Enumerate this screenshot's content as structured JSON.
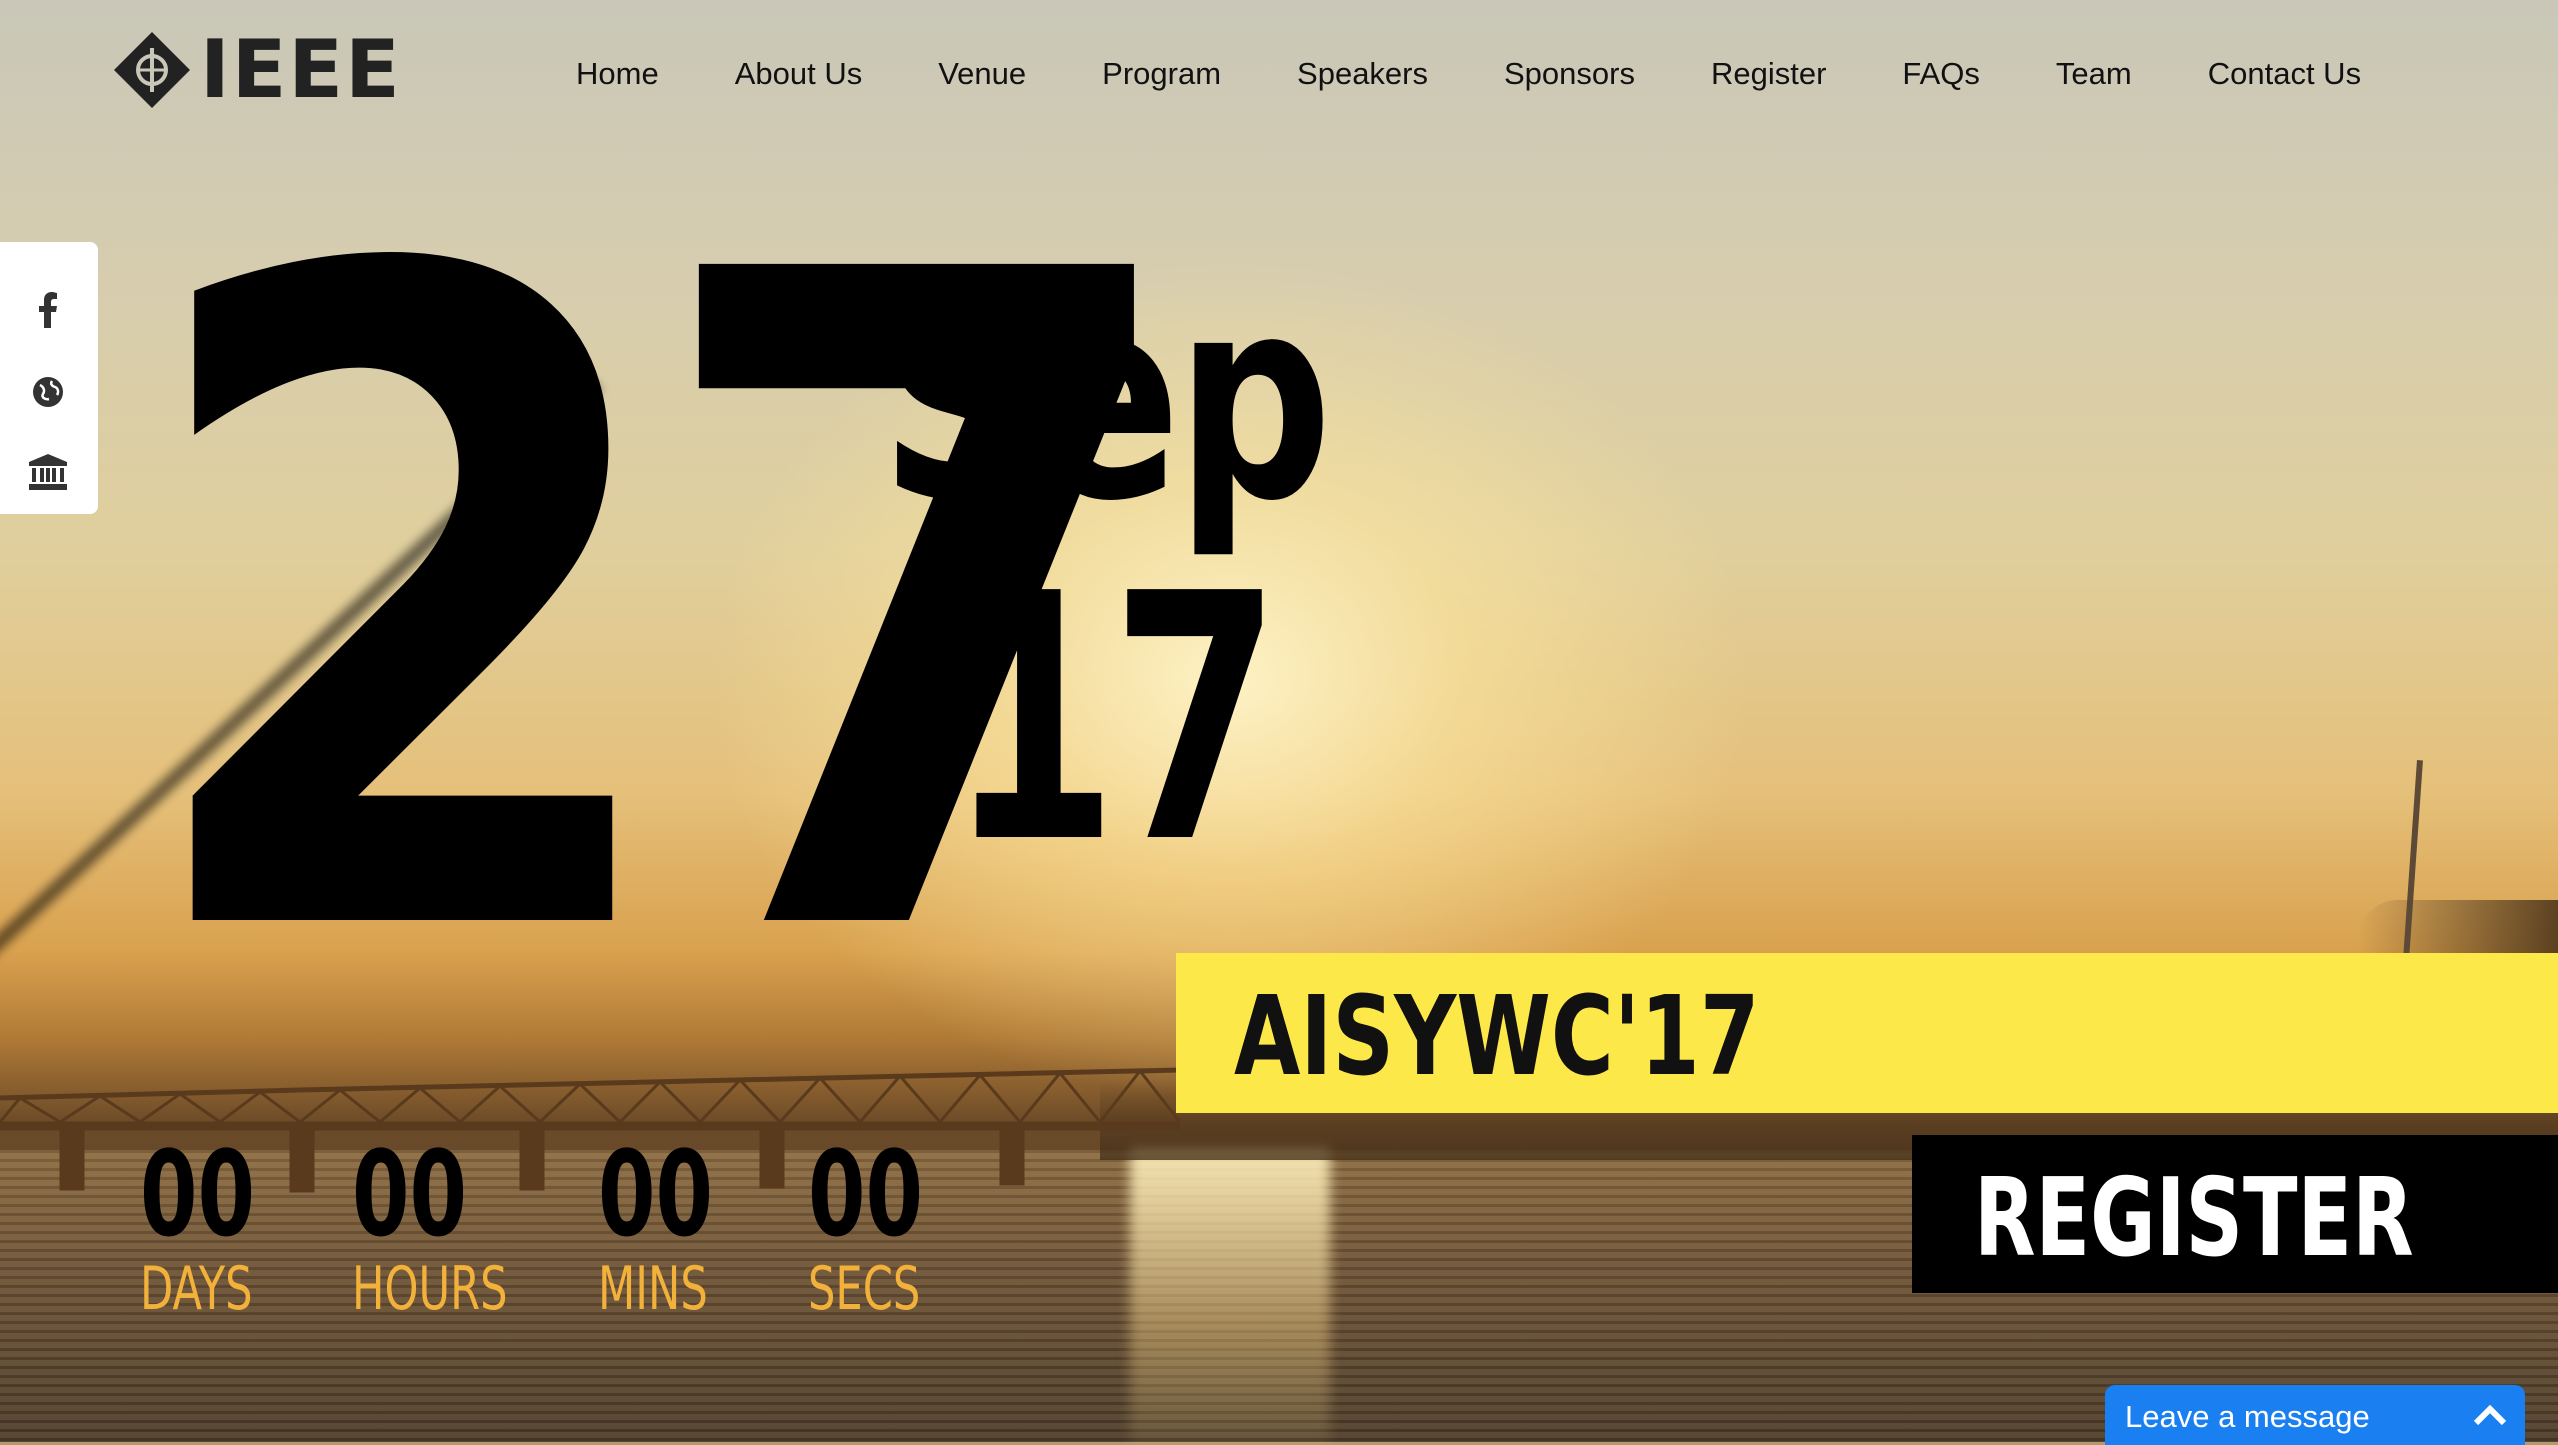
{
  "nav": {
    "logo_text": "IEEE",
    "items": [
      "Home",
      "About Us",
      "Venue",
      "Program",
      "Speakers",
      "Sponsors",
      "Register",
      "FAQs",
      "Team",
      "Contact Us"
    ]
  },
  "social": {
    "icons": [
      "facebook-icon",
      "globe-icon",
      "institution-icon"
    ]
  },
  "hero": {
    "day": "27",
    "month": "Sep",
    "year": "'17",
    "event_name": "AISYWC'17",
    "register_label": "REGISTER"
  },
  "countdown": [
    {
      "value": "00",
      "label": "DAYS"
    },
    {
      "value": "00",
      "label": "HOURS"
    },
    {
      "value": "00",
      "label": "MINS"
    },
    {
      "value": "00",
      "label": "SECS"
    }
  ],
  "chat": {
    "label": "Leave a message"
  },
  "colors": {
    "banner": "#fde84a",
    "countdown_label": "#f2b13a",
    "chat": "#1a7ff0"
  }
}
